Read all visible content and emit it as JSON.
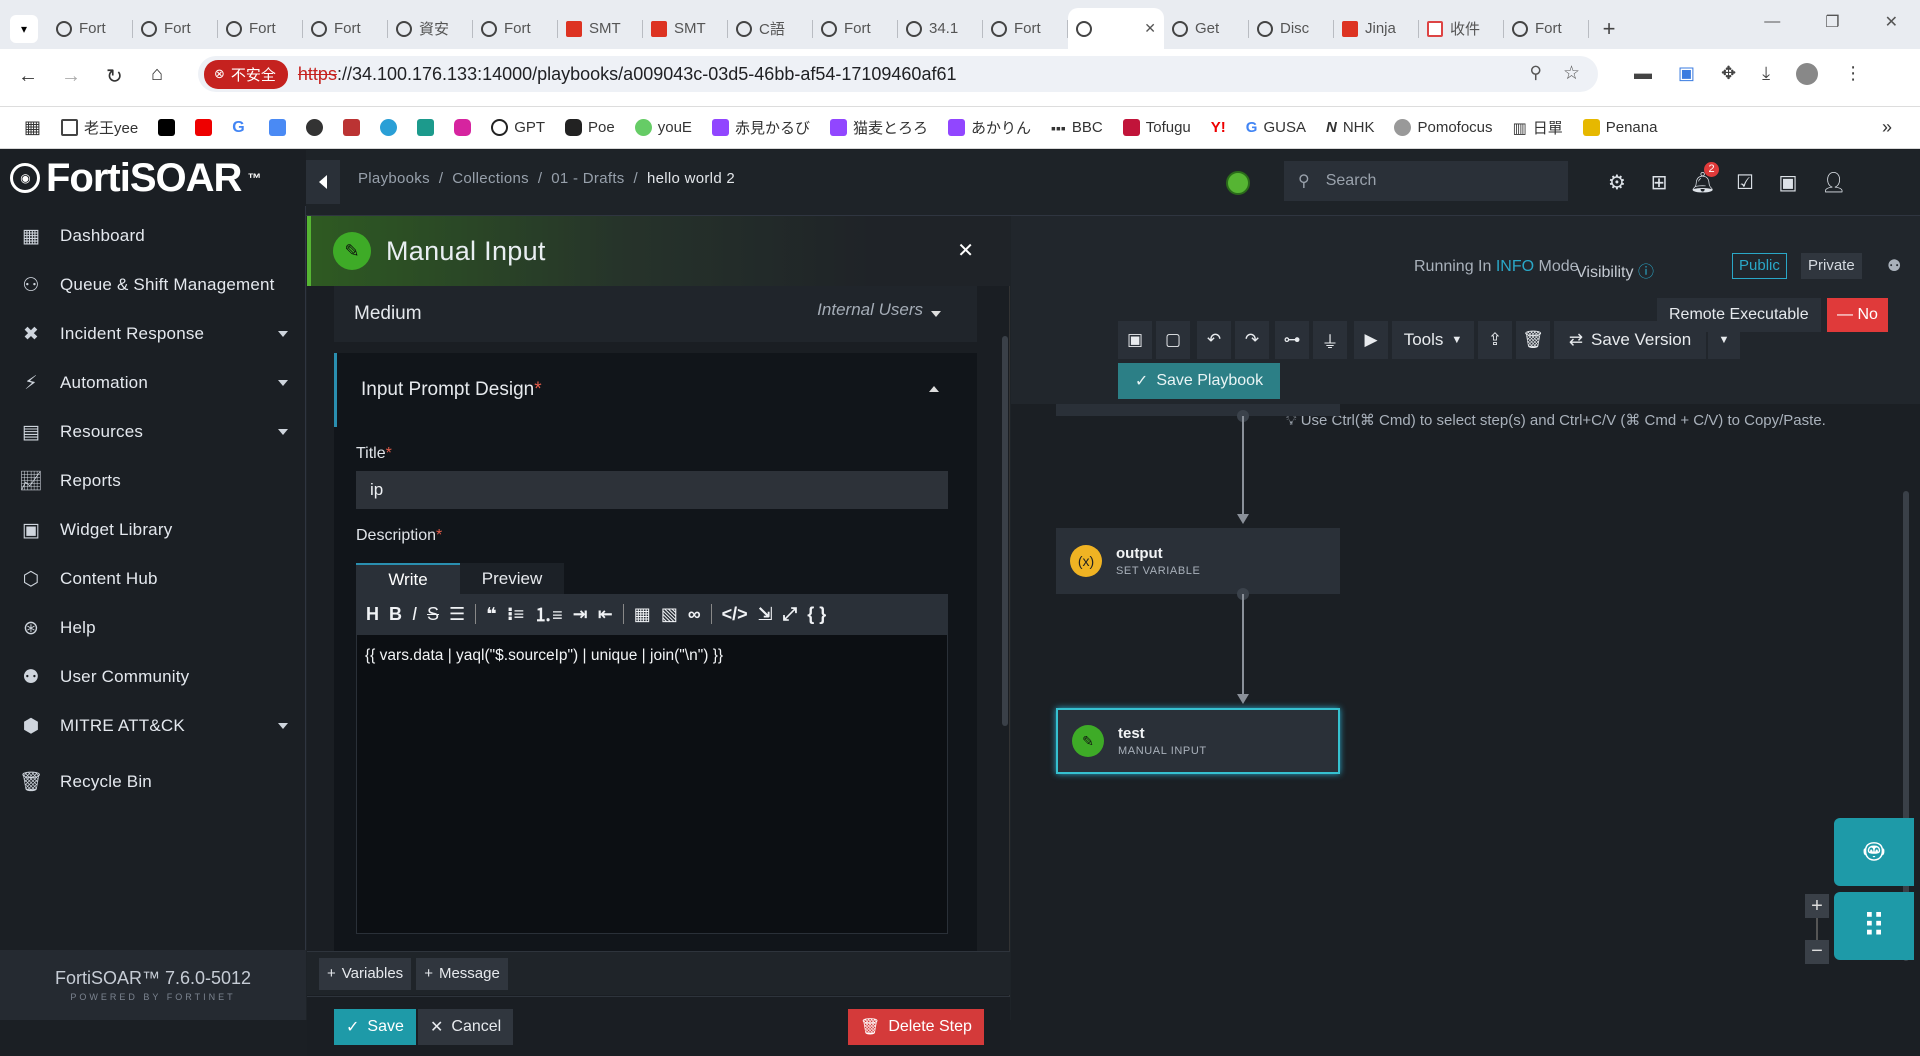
{
  "browser": {
    "tabs": [
      {
        "label": "Fort",
        "icon": "fortinet-icon"
      },
      {
        "label": "Fort",
        "icon": "fortinet-icon"
      },
      {
        "label": "Fort",
        "icon": "fortinet-icon"
      },
      {
        "label": "Fort",
        "icon": "fortinet-icon"
      },
      {
        "label": "資安",
        "icon": "chatgpt-icon"
      },
      {
        "label": "Fort",
        "icon": "fortinet-icon"
      },
      {
        "label": "SMT",
        "icon": "smt-icon"
      },
      {
        "label": "SMT",
        "icon": "smt-icon"
      },
      {
        "label": "C語",
        "icon": "chatgpt-icon"
      },
      {
        "label": "Fort",
        "icon": "fortinet-icon"
      },
      {
        "label": "34.1",
        "icon": "globe-icon"
      },
      {
        "label": "Fort",
        "icon": "fortinet-icon"
      },
      {
        "label": "",
        "icon": "chatgpt-icon",
        "active": true
      },
      {
        "label": "Get",
        "icon": "chatgpt-icon"
      },
      {
        "label": "Disc",
        "icon": "chatgpt-icon"
      },
      {
        "label": "Jinja",
        "icon": "smt-icon"
      },
      {
        "label": "收件",
        "icon": "gmail-icon"
      },
      {
        "label": "Fort",
        "icon": "fortinet-icon"
      }
    ],
    "security_label": "不安全",
    "url_scheme": "https",
    "url_rest": "://34.100.176.133:14000/playbooks/a009043c-03d5-46bb-af54-17109460af61",
    "bookmarks": [
      "老王yee",
      "",
      "",
      "",
      "",
      "",
      "",
      "",
      "",
      "",
      "GPT",
      "Poe",
      "youE",
      "赤見かるび",
      "猫麦とろろ",
      "あかりん",
      "BBC",
      "Tofugu",
      "",
      "GUSA",
      "NHK",
      "Pomofocus",
      "日單",
      "Penana"
    ]
  },
  "app": {
    "logo": "FortiSOAR",
    "logo_tm": "™",
    "nav": [
      {
        "label": "Dashboard",
        "icon": "dashboard-icon",
        "caret": false
      },
      {
        "label": "Queue & Shift Management",
        "icon": "queue-icon",
        "caret": false
      },
      {
        "label": "Incident Response",
        "icon": "incident-icon",
        "caret": true
      },
      {
        "label": "Automation",
        "icon": "automation-icon",
        "caret": true
      },
      {
        "label": "Resources",
        "icon": "resources-icon",
        "caret": true
      },
      {
        "label": "Reports",
        "icon": "reports-icon",
        "caret": false
      },
      {
        "label": "Widget Library",
        "icon": "widget-icon",
        "caret": false
      },
      {
        "label": "Content Hub",
        "icon": "content-hub-icon",
        "caret": false
      },
      {
        "label": "Help",
        "icon": "help-icon",
        "caret": false
      },
      {
        "label": "User Community",
        "icon": "community-icon",
        "caret": false
      },
      {
        "label": "MITRE ATT&CK",
        "icon": "mitre-icon",
        "caret": true
      },
      {
        "label": "Recycle Bin",
        "icon": "recycle-bin-icon",
        "caret": false
      }
    ],
    "version": "FortiSOAR™ 7.6.0-5012",
    "powered": "POWERED BY FORTINET",
    "breadcrumb": [
      "Playbooks",
      "Collections",
      "01 - Drafts"
    ],
    "breadcrumb_current": "hello world 2",
    "search_placeholder": "Search",
    "notification_count": "2"
  },
  "panel": {
    "title": "Manual Input",
    "medium_label": "Medium",
    "medium_value": "Internal Users",
    "section_title": "Input Prompt Design",
    "title_label": "Title",
    "title_value": "ip",
    "description_label": "Description",
    "tab_write": "Write",
    "tab_preview": "Preview",
    "description_value": "{{ vars.data | yaql(\"$.sourceIp\") | unique | join(\"\\n\") }}",
    "variables_btn": "Variables",
    "message_btn": "Message",
    "save_btn": "Save",
    "cancel_btn": "Cancel",
    "delete_btn": "Delete Step"
  },
  "canvas": {
    "running_prefix": "Running In",
    "running_mode": "INFO",
    "running_suffix": "Mode",
    "visibility_label": "Visibility",
    "public_label": "Public",
    "private_label": "Private",
    "remote_label": "Remote Executable",
    "remote_value": "— No",
    "tools_label": "Tools",
    "save_version_label": "Save Version",
    "save_playbook_label": "Save Playbook",
    "hint": "Use Ctrl(⌘ Cmd) to select step(s) and Ctrl+C/V (⌘ Cmd + C/V) to Copy/Paste.",
    "nodes": [
      {
        "title": "output",
        "subtitle": "SET VARIABLE",
        "icon": "(x)"
      },
      {
        "title": "test",
        "subtitle": "MANUAL INPUT",
        "icon": "✎"
      }
    ]
  }
}
